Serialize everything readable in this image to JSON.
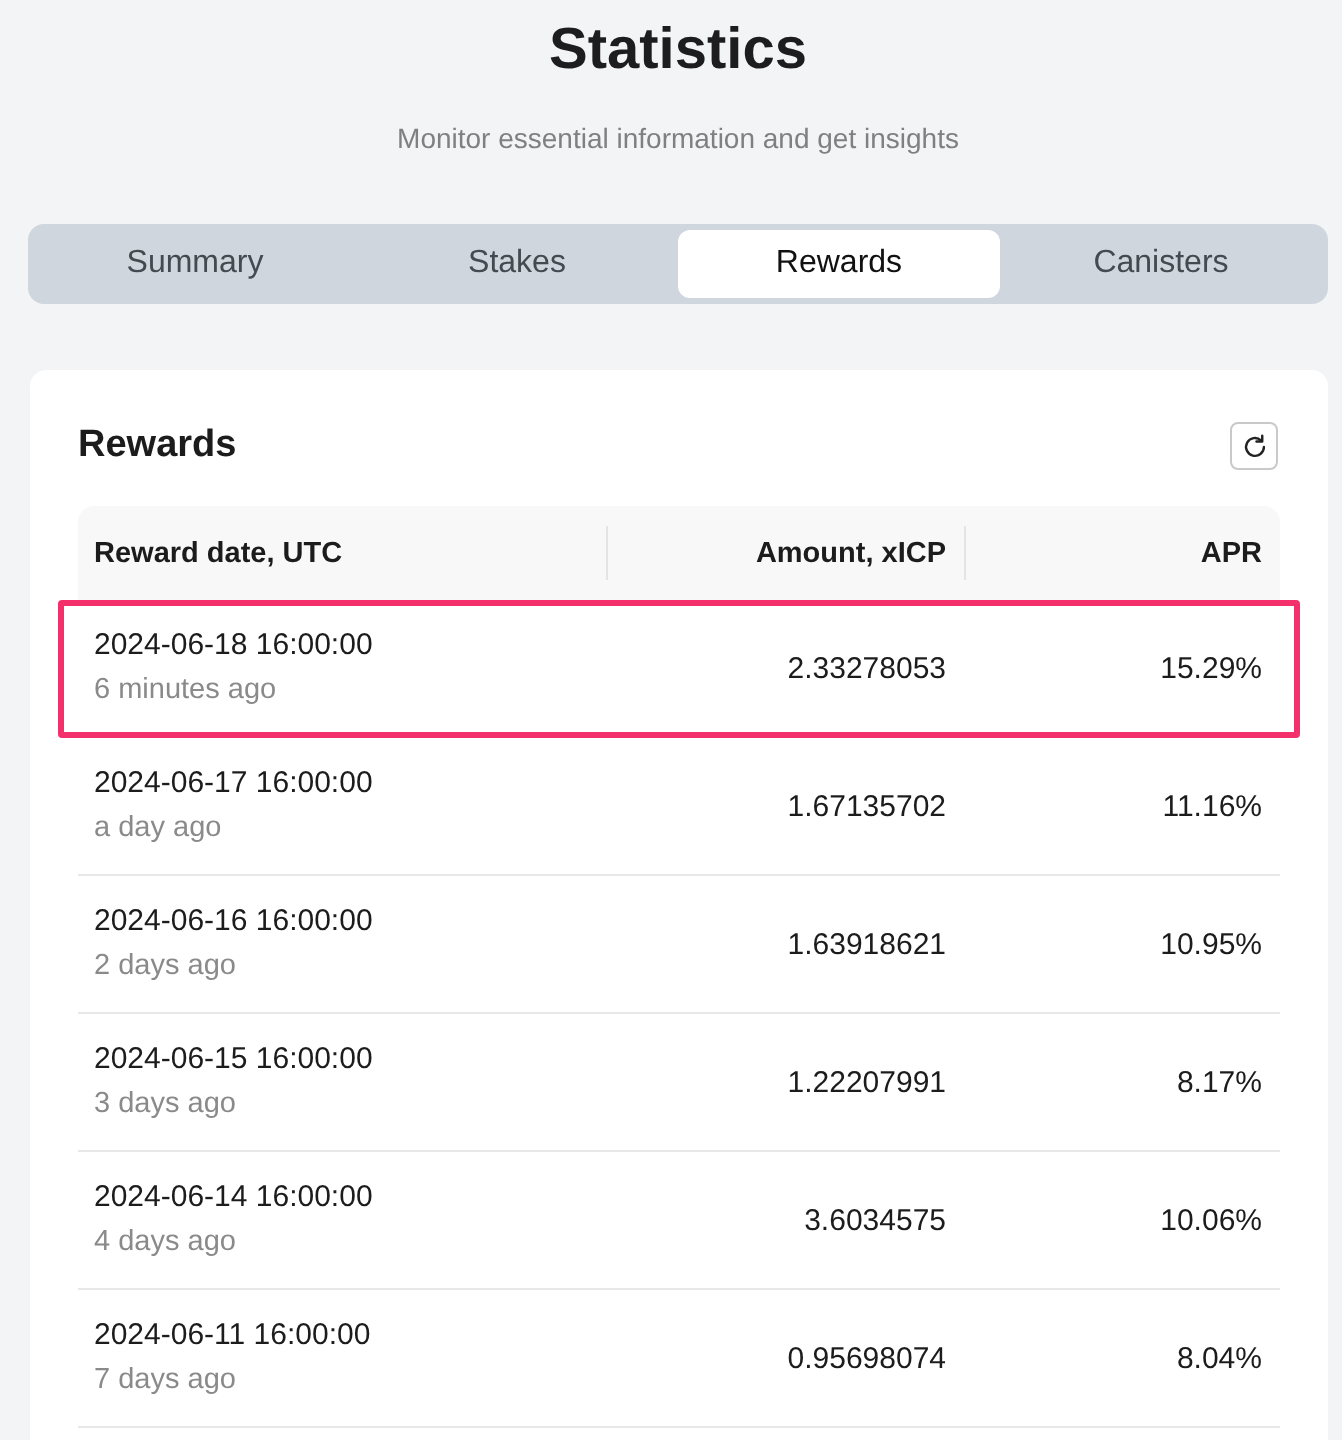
{
  "page": {
    "title": "Statistics",
    "subtitle": "Monitor essential information and get insights"
  },
  "tabs": [
    {
      "label": "Summary",
      "selected": false
    },
    {
      "label": "Stakes",
      "selected": false
    },
    {
      "label": "Rewards",
      "selected": true
    },
    {
      "label": "Canisters",
      "selected": false
    }
  ],
  "card": {
    "title": "Rewards"
  },
  "table": {
    "columns": [
      "Reward date, UTC",
      "Amount, xICP",
      "APR"
    ],
    "rows": [
      {
        "date": "2024-06-18 16:00:00",
        "relative": "6 minutes ago",
        "amount": "2.33278053",
        "apr": "15.29%",
        "highlighted": true
      },
      {
        "date": "2024-06-17 16:00:00",
        "relative": "a day ago",
        "amount": "1.67135702",
        "apr": "11.16%",
        "highlighted": false
      },
      {
        "date": "2024-06-16 16:00:00",
        "relative": "2 days ago",
        "amount": "1.63918621",
        "apr": "10.95%",
        "highlighted": false
      },
      {
        "date": "2024-06-15 16:00:00",
        "relative": "3 days ago",
        "amount": "1.22207991",
        "apr": "8.17%",
        "highlighted": false
      },
      {
        "date": "2024-06-14 16:00:00",
        "relative": "4 days ago",
        "amount": "3.6034575",
        "apr": "10.06%",
        "highlighted": false
      },
      {
        "date": "2024-06-11 16:00:00",
        "relative": "7 days ago",
        "amount": "0.95698074",
        "apr": "8.04%",
        "highlighted": false
      }
    ]
  }
}
